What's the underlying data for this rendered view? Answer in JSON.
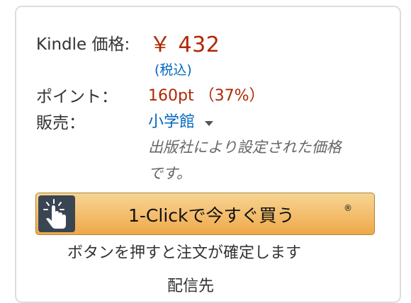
{
  "price": {
    "label": "Kindle 価格:",
    "value": "￥ 432",
    "tax_note": "(税込)"
  },
  "points": {
    "label": "ポイント：",
    "value": "160pt （37%）"
  },
  "seller": {
    "label": "販売：",
    "name": "小学館",
    "note_line1": "出版社により設定された価格",
    "note_line2": "です。"
  },
  "one_click": {
    "label": "1-Clickで今すぐ買う",
    "registered_mark": "®",
    "confirm_text": "ボタンを押すと注文が確定します"
  },
  "footer": {
    "cut_text": "配信先"
  },
  "colors": {
    "price_red": "#b12704",
    "link_blue": "#0066c0",
    "button_orange": "#f0a84a"
  },
  "icons": {
    "one_click": "tap-hand-icon",
    "dropdown": "caret-down-icon"
  }
}
